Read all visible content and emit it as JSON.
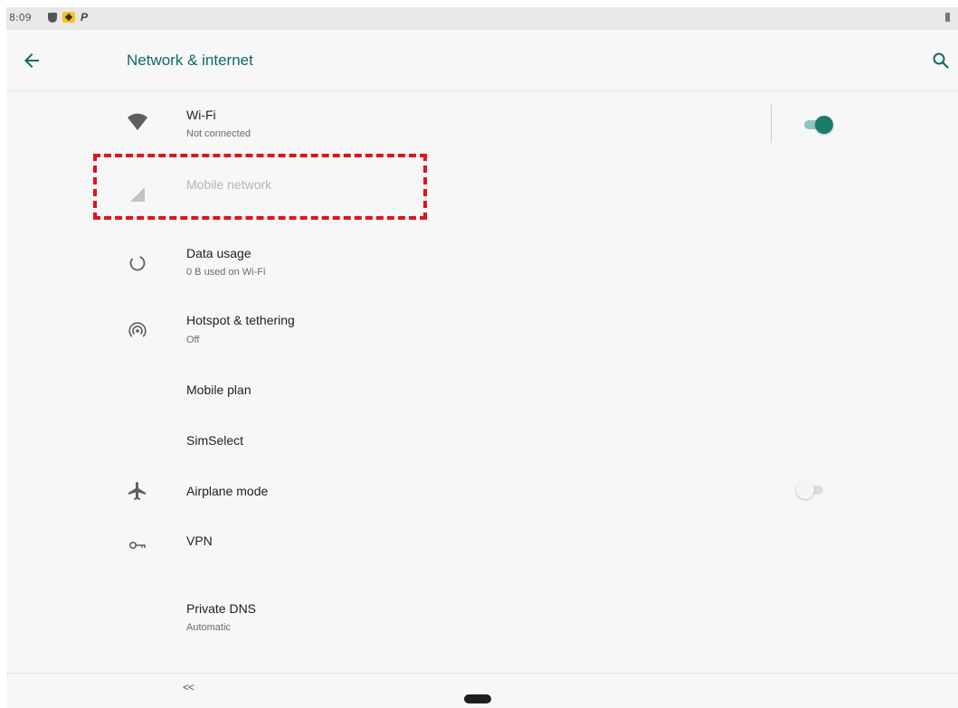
{
  "status_bar": {
    "time": "8:09",
    "icons": [
      "shield-icon",
      "notification-icon",
      "p-icon"
    ],
    "p_glyph": "P"
  },
  "app_bar": {
    "title": "Network & internet",
    "back_icon": "back-arrow-icon",
    "search_icon": "search-icon"
  },
  "colors": {
    "accent": "#116b5f",
    "toggle_on": "#1a7a6c",
    "highlight": "#e0141b"
  },
  "items": [
    {
      "title": "Wi-Fi",
      "subtitle": "Not connected",
      "icon": "wifi-icon",
      "toggle": true,
      "enabled": true
    },
    {
      "title": "Mobile network",
      "icon": "cellular-signal-icon",
      "enabled": false
    },
    {
      "title": "Data usage",
      "subtitle": "0 B used on Wi-Fi",
      "icon": "data-usage-icon",
      "enabled": true
    },
    {
      "title": "Hotspot & tethering",
      "subtitle": "Off",
      "icon": "hotspot-icon",
      "enabled": true
    },
    {
      "title": "Mobile plan",
      "enabled": true
    },
    {
      "title": "SimSelect",
      "enabled": true
    },
    {
      "title": "Airplane mode",
      "icon": "airplane-icon",
      "toggle": false,
      "enabled": true
    },
    {
      "title": "VPN",
      "icon": "vpn-key-icon",
      "enabled": true
    },
    {
      "title": "Private DNS",
      "subtitle": "Automatic",
      "enabled": true
    }
  ],
  "nav": {
    "back_label": "<<",
    "home_icon": "home-pill-icon"
  }
}
